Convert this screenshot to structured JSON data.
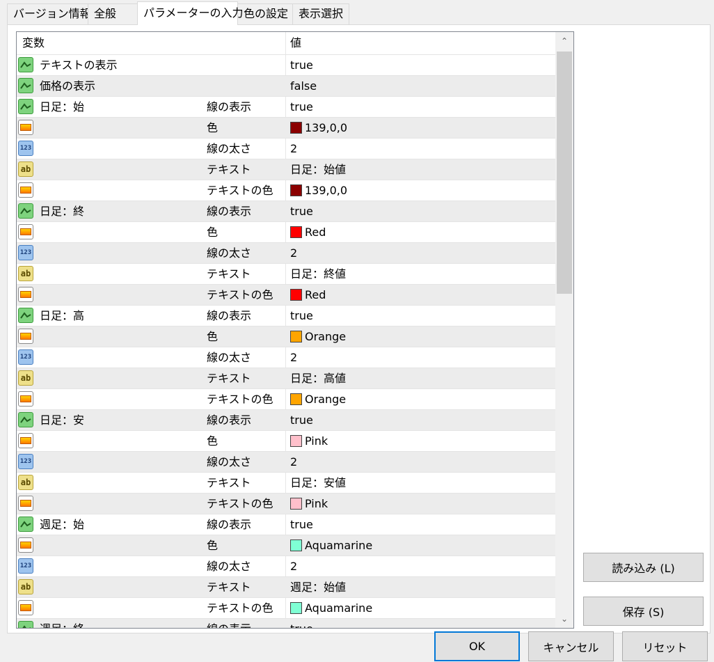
{
  "tabs": [
    {
      "label": "バージョン情報"
    },
    {
      "label": "全般"
    },
    {
      "label": "パラメーターの入力"
    },
    {
      "label": "色の設定"
    },
    {
      "label": "表示選択"
    }
  ],
  "grid": {
    "header_variable": "変数",
    "header_value": "値",
    "rows": [
      {
        "type": "bool",
        "category": "テキストの表示",
        "param": "",
        "value": "true"
      },
      {
        "type": "bool",
        "category": "価格の表示",
        "param": "",
        "value": "false"
      },
      {
        "type": "bool",
        "category": "日足：始",
        "param": "線の表示",
        "value": "true"
      },
      {
        "type": "color",
        "category": "",
        "param": "色",
        "value": "139,0,0",
        "swatch": "#8b0000"
      },
      {
        "type": "num",
        "category": "",
        "param": "線の太さ",
        "value": "2"
      },
      {
        "type": "str",
        "category": "",
        "param": "テキスト",
        "value": "日足：始値"
      },
      {
        "type": "color",
        "category": "",
        "param": "テキストの色",
        "value": "139,0,0",
        "swatch": "#8b0000"
      },
      {
        "type": "bool",
        "category": "日足：終",
        "param": "線の表示",
        "value": "true"
      },
      {
        "type": "color",
        "category": "",
        "param": "色",
        "value": "Red",
        "swatch": "#ff0000"
      },
      {
        "type": "num",
        "category": "",
        "param": "線の太さ",
        "value": "2"
      },
      {
        "type": "str",
        "category": "",
        "param": "テキスト",
        "value": "日足：終値"
      },
      {
        "type": "color",
        "category": "",
        "param": "テキストの色",
        "value": "Red",
        "swatch": "#ff0000"
      },
      {
        "type": "bool",
        "category": "日足：高",
        "param": "線の表示",
        "value": "true"
      },
      {
        "type": "color",
        "category": "",
        "param": "色",
        "value": "Orange",
        "swatch": "#ffa500"
      },
      {
        "type": "num",
        "category": "",
        "param": "線の太さ",
        "value": "2"
      },
      {
        "type": "str",
        "category": "",
        "param": "テキスト",
        "value": "日足：高値"
      },
      {
        "type": "color",
        "category": "",
        "param": "テキストの色",
        "value": "Orange",
        "swatch": "#ffa500"
      },
      {
        "type": "bool",
        "category": "日足：安",
        "param": "線の表示",
        "value": "true"
      },
      {
        "type": "color",
        "category": "",
        "param": "色",
        "value": "Pink",
        "swatch": "#ffc0cb"
      },
      {
        "type": "num",
        "category": "",
        "param": "線の太さ",
        "value": "2"
      },
      {
        "type": "str",
        "category": "",
        "param": "テキスト",
        "value": "日足：安値"
      },
      {
        "type": "color",
        "category": "",
        "param": "テキストの色",
        "value": "Pink",
        "swatch": "#ffc0cb"
      },
      {
        "type": "bool",
        "category": "週足：始",
        "param": "線の表示",
        "value": "true"
      },
      {
        "type": "color",
        "category": "",
        "param": "色",
        "value": "Aquamarine",
        "swatch": "#7fffd4"
      },
      {
        "type": "num",
        "category": "",
        "param": "線の太さ",
        "value": "2"
      },
      {
        "type": "str",
        "category": "",
        "param": "テキスト",
        "value": "週足：始値"
      },
      {
        "type": "color",
        "category": "",
        "param": "テキストの色",
        "value": "Aquamarine",
        "swatch": "#7fffd4"
      },
      {
        "type": "bool",
        "category": "週足：終",
        "param": "線の表示",
        "value": "true"
      }
    ]
  },
  "buttons": {
    "load": "読み込み (L)",
    "save": "保存 (S)",
    "ok": "OK",
    "cancel": "キャンセル",
    "reset": "リセット"
  },
  "icons": {
    "bool": "bool-param-icon",
    "color": "color-param-icon",
    "num": "number-param-icon",
    "str": "string-param-icon"
  }
}
